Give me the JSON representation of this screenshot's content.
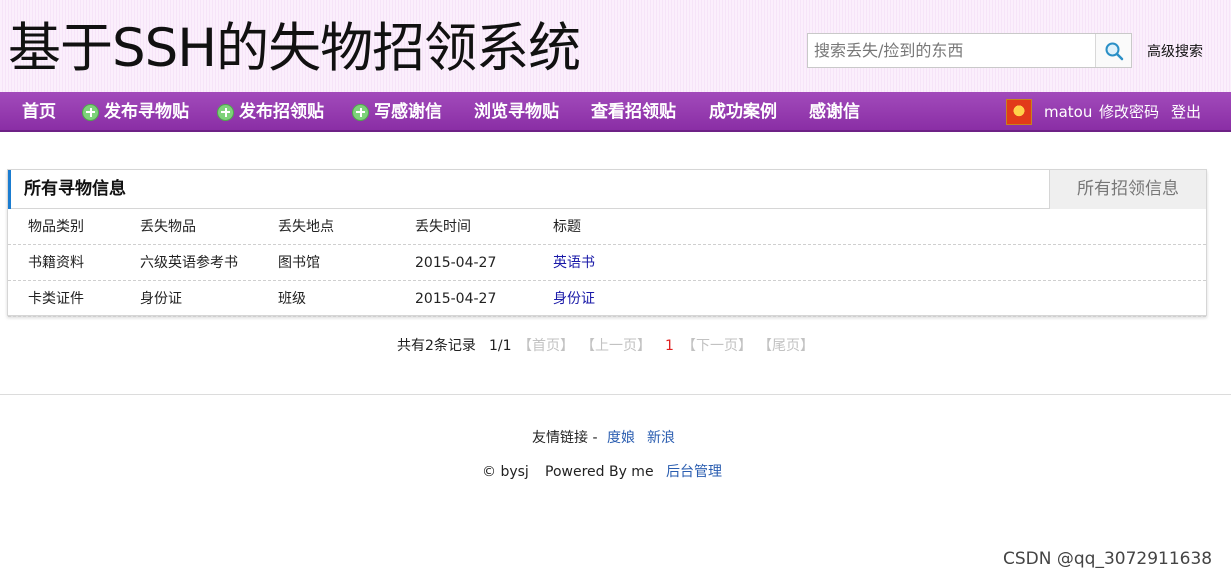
{
  "header": {
    "site_title": "基于SSH的失物招领系统",
    "search_placeholder": "搜索丢失/捡到的东西",
    "search_icon": "search-icon",
    "advanced_search": "高级搜索"
  },
  "nav": {
    "items": [
      {
        "label": "首页",
        "icon": ""
      },
      {
        "label": "发布寻物贴",
        "icon": "plus-icon"
      },
      {
        "label": "发布招领贴",
        "icon": "plus-icon"
      },
      {
        "label": "写感谢信",
        "icon": "plus-icon"
      },
      {
        "label": "浏览寻物贴",
        "icon": ""
      },
      {
        "label": "查看招领贴",
        "icon": ""
      },
      {
        "label": "成功案例",
        "icon": ""
      },
      {
        "label": "感谢信",
        "icon": ""
      }
    ],
    "user": {
      "avatar": "avatar",
      "name": "matou",
      "change_password": "修改密码",
      "logout": "登出"
    }
  },
  "panel": {
    "title": "所有寻物信息",
    "tab": "所有招领信息",
    "columns": [
      "物品类别",
      "丢失物品",
      "丢失地点",
      "丢失时间",
      "标题"
    ],
    "rows": [
      [
        "书籍资料",
        "六级英语参考书",
        "图书馆",
        "2015-04-27",
        "英语书"
      ],
      [
        "卡类证件",
        "身份证",
        "班级",
        "2015-04-27",
        "身份证"
      ]
    ]
  },
  "pager": {
    "total": "共有2条记录",
    "pages": "1/1",
    "first": "【首页】",
    "prev": "【上一页】",
    "current": "1",
    "next": "【下一页】",
    "last": "【尾页】"
  },
  "footer": {
    "links_label": "友情链接 -",
    "link1": "度娘",
    "link2": "新浪",
    "copyright": "© bysj",
    "powered": "Powered By me",
    "admin": "后台管理"
  },
  "watermark": "CSDN @qq_3072911638",
  "colors": {
    "nav": "#9a40b5",
    "header_bg": "#fbeefc",
    "accent": "#1a7cd0",
    "link": "#1a1aa8",
    "current_page": "#e02020"
  }
}
